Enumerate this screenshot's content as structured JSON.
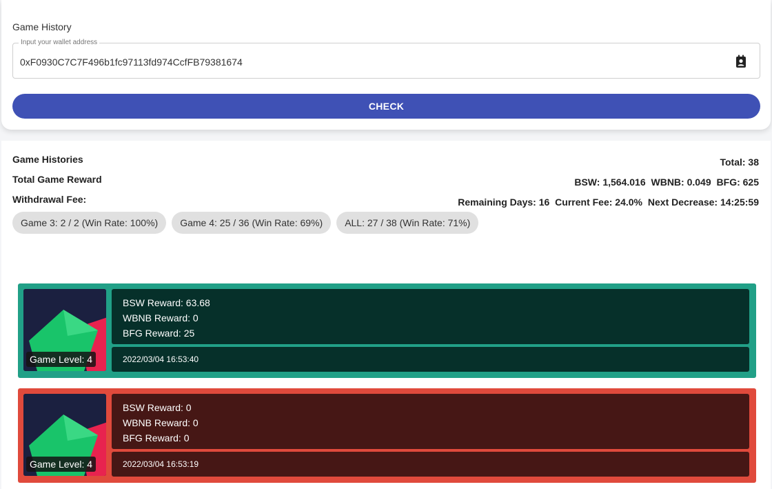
{
  "form": {
    "title": "Game History",
    "wallet_label": "Input your wallet address",
    "wallet_value": "0xF0930C7C7F496b1fc97113fd974CcfFB79381674",
    "check_label": "CHECK"
  },
  "summary": {
    "histories_label": "Game Histories",
    "total_reward_label": "Total Game Reward",
    "withdrawal_fee_label": "Withdrawal Fee:",
    "total": "Total: 38",
    "bsw": "BSW: 1,564.016",
    "wbnb": "WBNB: 0.049",
    "bfg": "BFG: 625",
    "remaining_days": "Remaining Days: 16",
    "current_fee": "Current Fee: 24.0%",
    "next_decrease": "Next Decrease: 14:25:59"
  },
  "chips": [
    "Game 3: 2 / 2 (Win Rate: 100%)",
    "Game 4: 25 / 36 (Win Rate: 69%)",
    "ALL: 27 / 38 (Win Rate: 71%)"
  ],
  "games": [
    {
      "result": "win",
      "level": "Game Level: 4",
      "bsw": "BSW Reward: 63.68",
      "wbnb": "WBNB Reward: 0",
      "bfg": "BFG Reward: 25",
      "date": "2022/03/04 16:53:40"
    },
    {
      "result": "loss",
      "level": "Game Level: 4",
      "bsw": "BSW Reward: 0",
      "wbnb": "WBNB Reward: 0",
      "bfg": "BFG Reward: 0",
      "date": "2022/03/04 16:53:19"
    }
  ],
  "colors": {
    "accent": "#3f51b5",
    "win_border": "#21a087",
    "win_panel": "#06302a",
    "loss_border": "#e04a3c",
    "loss_panel": "#461715"
  },
  "icons": {
    "wallet_action": "contact-clipboard-icon"
  }
}
